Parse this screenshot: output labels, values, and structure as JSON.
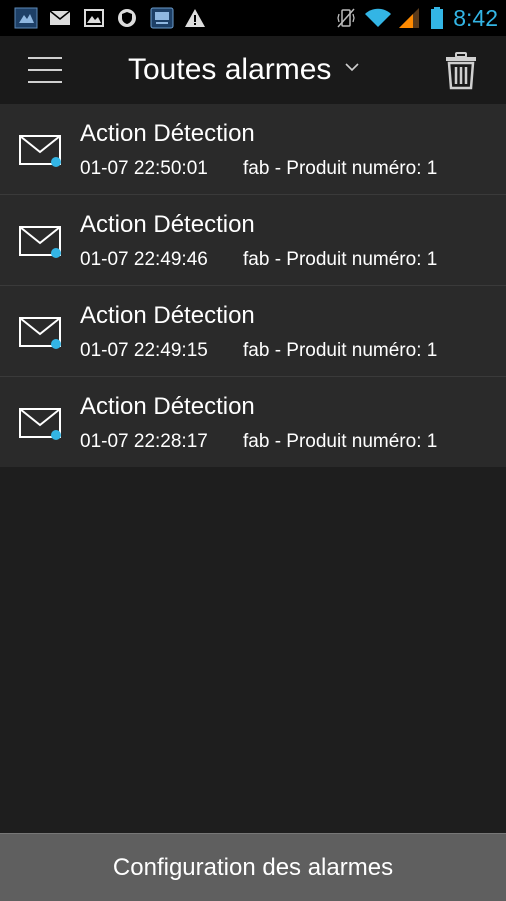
{
  "status_bar": {
    "time": "8:42",
    "accent_color": "#33b5e5",
    "notification_icons": [
      "app-icon",
      "email-icon",
      "gallery-icon",
      "security-icon",
      "remote-app-icon",
      "warning-icon"
    ],
    "system_icons": [
      "vibrate-icon",
      "wifi-icon",
      "signal-icon",
      "battery-icon"
    ]
  },
  "action_bar": {
    "title": "Toutes alarmes",
    "menu_icon": "hamburger-menu-icon",
    "dropdown_icon": "chevron-down-icon",
    "delete_icon": "trash-icon"
  },
  "alarms": [
    {
      "title": "Action Détection",
      "time": "01-07 22:50:01",
      "description": "fab - Produit numéro: 1"
    },
    {
      "title": "Action Détection",
      "time": "01-07 22:49:46",
      "description": "fab - Produit numéro: 1"
    },
    {
      "title": "Action Détection",
      "time": "01-07 22:49:15",
      "description": "fab - Produit numéro: 1"
    },
    {
      "title": "Action Détection",
      "time": "01-07 22:28:17",
      "description": "fab - Produit numéro: 1"
    }
  ],
  "bottom": {
    "button_label": "Configuration des alarmes"
  }
}
